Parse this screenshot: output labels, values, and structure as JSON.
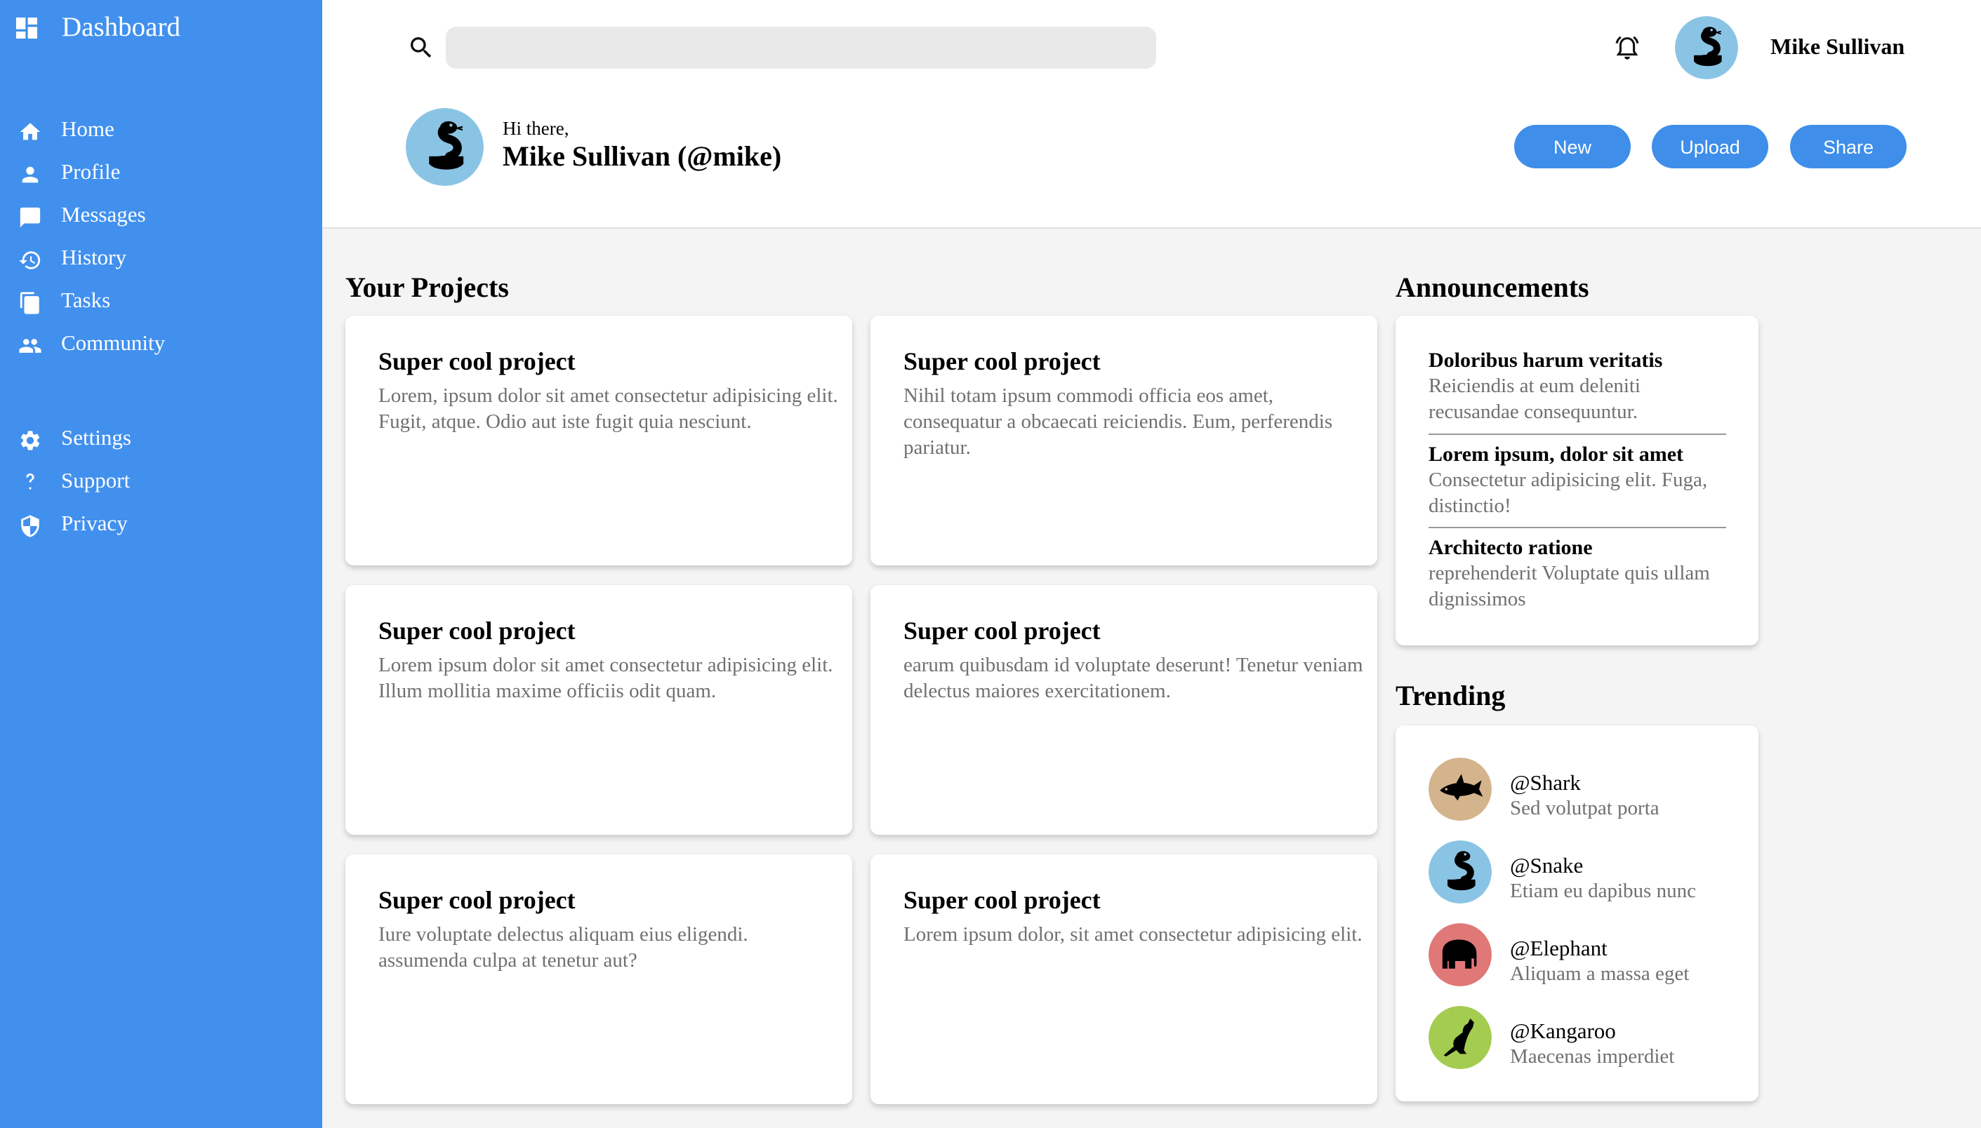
{
  "sidebar": {
    "brand": "Dashboard",
    "items": [
      {
        "label": "Home",
        "icon": "home-icon"
      },
      {
        "label": "Profile",
        "icon": "user-icon"
      },
      {
        "label": "Messages",
        "icon": "chat-icon"
      },
      {
        "label": "History",
        "icon": "history-icon"
      },
      {
        "label": "Tasks",
        "icon": "tasks-icon"
      },
      {
        "label": "Community",
        "icon": "group-icon"
      }
    ],
    "secondary_items": [
      {
        "label": "Settings",
        "icon": "gear-icon"
      },
      {
        "label": "Support",
        "icon": "help-icon"
      },
      {
        "label": "Privacy",
        "icon": "shield-icon"
      }
    ]
  },
  "header": {
    "search": {
      "placeholder": "",
      "value": ""
    },
    "user_name": "Mike Sullivan",
    "greeting": "Hi there,",
    "full_name": "Mike Sullivan (@mike)",
    "buttons": {
      "new": "New",
      "upload": "Upload",
      "share": "Share"
    }
  },
  "projects": {
    "title": "Your Projects",
    "items": [
      {
        "title": "Super cool project",
        "desc": "Lorem, ipsum dolor sit amet consectetur adipisicing elit. Fugit, atque. Odio aut iste fugit quia nesciunt."
      },
      {
        "title": "Super cool project",
        "desc": "Nihil totam ipsum commodi officia eos amet, consequatur a obcaecati reiciendis. Eum, perferendis pariatur."
      },
      {
        "title": "Super cool project",
        "desc": "Lorem ipsum dolor sit amet consectetur adipisicing elit. Illum mollitia maxime officiis odit quam."
      },
      {
        "title": "Super cool project",
        "desc": "earum quibusdam id voluptate deserunt! Tenetur veniam delectus maiores exercitationem."
      },
      {
        "title": "Super cool project",
        "desc": "Iure voluptate delectus aliquam eius eligendi. assumenda culpa at tenetur aut?"
      },
      {
        "title": "Super cool project",
        "desc": "Lorem ipsum dolor, sit amet consectetur adipisicing elit."
      }
    ]
  },
  "announcements": {
    "title": "Announcements",
    "items": [
      {
        "title": "Doloribus harum veritatis",
        "desc": "Reiciendis at eum deleniti recusandae consequuntur."
      },
      {
        "title": "Lorem ipsum, dolor sit amet",
        "desc": "Consectetur adipisicing elit. Fuga, distinctio!"
      },
      {
        "title": "Architecto ratione",
        "desc": "reprehenderit Voluptate quis ullam dignissimos"
      }
    ]
  },
  "trending": {
    "title": "Trending",
    "items": [
      {
        "handle": "@Shark",
        "desc": "Sed volutpat porta",
        "color": "#d4b48c",
        "icon": "shark-icon"
      },
      {
        "handle": "@Snake",
        "desc": "Etiam eu dapibus nunc",
        "color": "#8ac4e4",
        "icon": "snake-icon"
      },
      {
        "handle": "@Elephant",
        "desc": "Aliquam a massa eget",
        "color": "#e07878",
        "icon": "elephant-icon"
      },
      {
        "handle": "@Kangaroo",
        "desc": "Maecenas imperdiet",
        "color": "#a4cc50",
        "icon": "kangaroo-icon"
      }
    ]
  },
  "colors": {
    "sidebar": "#4190ee",
    "button": "#3e8eea",
    "avatar_bg": "#8ac4e4"
  }
}
